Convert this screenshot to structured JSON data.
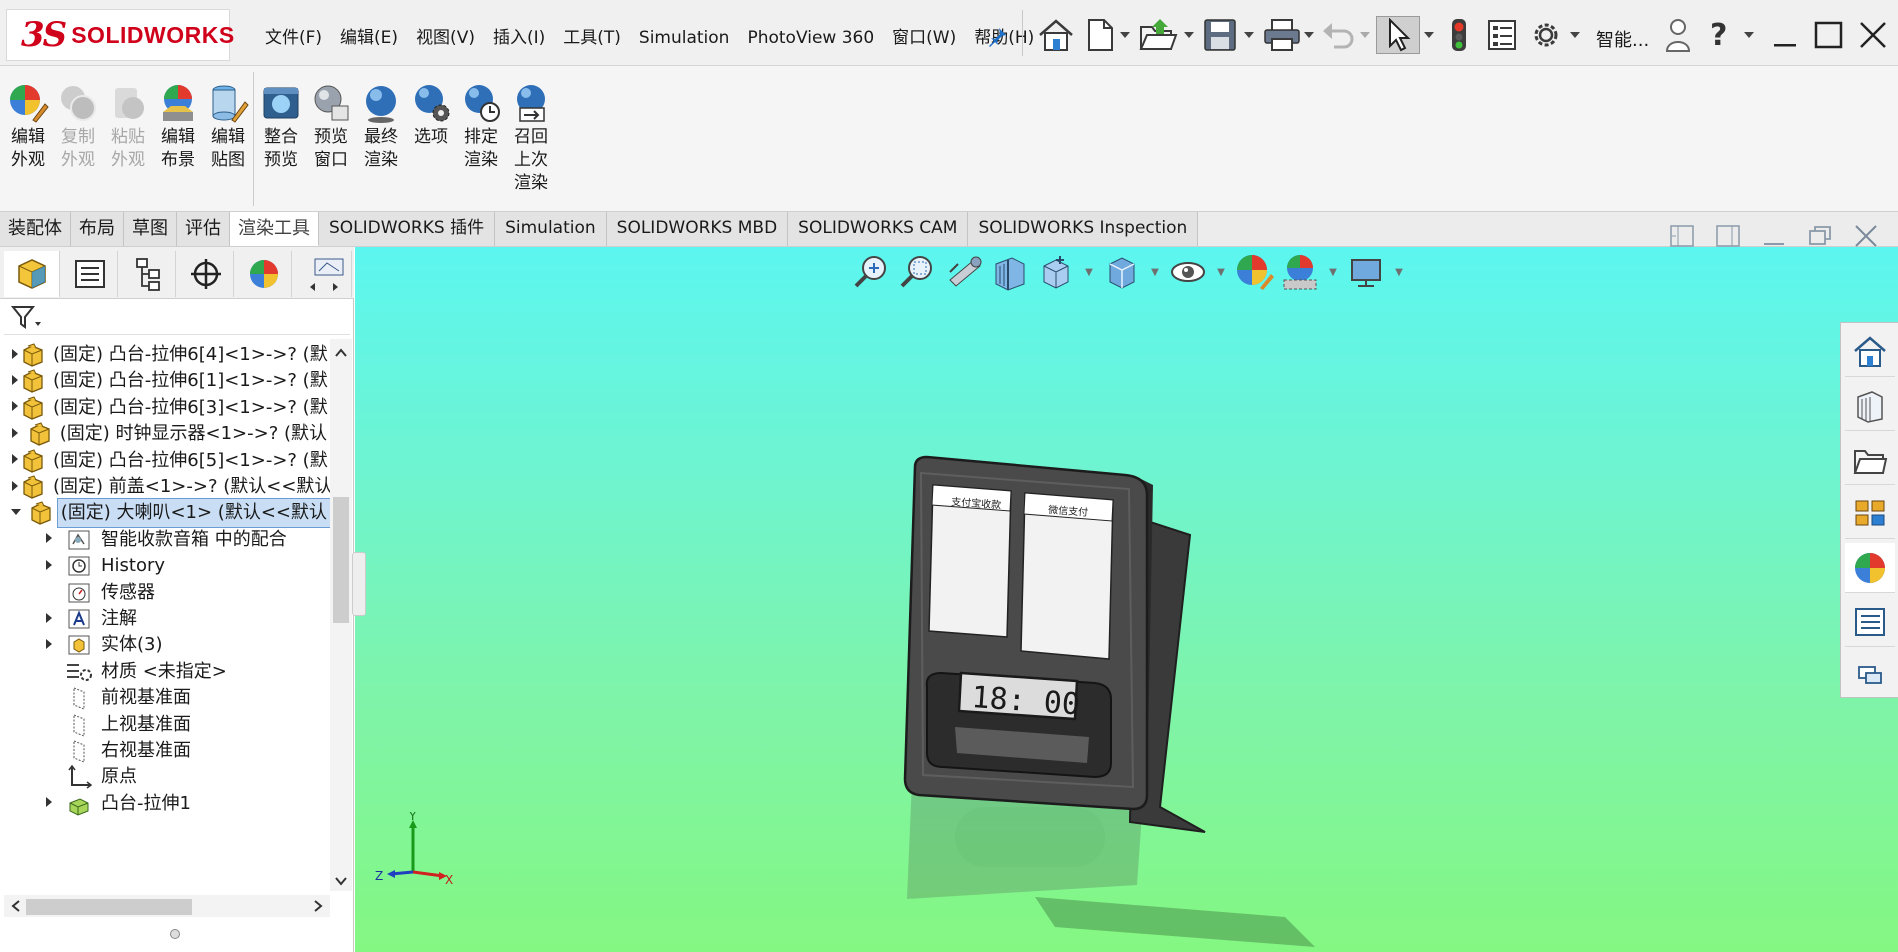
{
  "app": {
    "logo_mark": "3S",
    "logo_text": "SOLIDWORKS"
  },
  "menubar": {
    "items": [
      "文件(F)",
      "编辑(E)",
      "视图(V)",
      "插入(I)",
      "工具(T)",
      "Simulation",
      "PhotoView 360",
      "窗口(W)",
      "帮助(H)"
    ]
  },
  "quick_access": {
    "icons": [
      "home-icon",
      "new-document-icon",
      "open-icon",
      "save-icon",
      "print-icon",
      "undo-icon",
      "select-pointer-icon",
      "traffic-light-icon",
      "file-properties-icon",
      "options-gear-icon"
    ],
    "smart_label": "智能...",
    "help_glyph": "?"
  },
  "ribbon": {
    "buttons": [
      {
        "label": "编辑外观",
        "icon": "edit-appearance-icon",
        "enabled": true
      },
      {
        "label": "复制外观",
        "icon": "copy-appearance-icon",
        "enabled": false
      },
      {
        "label": "粘贴外观",
        "icon": "paste-appearance-icon",
        "enabled": false
      },
      {
        "label": "编辑布景",
        "icon": "edit-scene-icon",
        "enabled": true
      },
      {
        "label": "编辑贴图",
        "icon": "edit-decal-icon",
        "enabled": true
      },
      {
        "label": "整合预览",
        "icon": "integrated-preview-icon",
        "enabled": true
      },
      {
        "label": "预览窗口",
        "icon": "preview-window-icon",
        "enabled": true
      },
      {
        "label": "最终渲染",
        "icon": "final-render-icon",
        "enabled": true
      },
      {
        "label": "选项",
        "icon": "render-options-icon",
        "enabled": true
      },
      {
        "label": "排定渲染",
        "icon": "schedule-render-icon",
        "enabled": true
      },
      {
        "label": "召回上次渲染",
        "icon": "recall-last-render-icon",
        "enabled": true
      }
    ]
  },
  "tabs": {
    "items": [
      "装配体",
      "布局",
      "草图",
      "评估",
      "渲染工具",
      "SOLIDWORKS 插件",
      "Simulation",
      "SOLIDWORKS MBD",
      "SOLIDWORKS CAM",
      "SOLIDWORKS Inspection"
    ],
    "active": "渲染工具"
  },
  "feature_tree": {
    "rows": [
      {
        "text": "(固定) 凸台-拉伸6[4]<1>->? (默",
        "icon": "part-icon",
        "expander": "collapsed",
        "indent": 0
      },
      {
        "text": "(固定) 凸台-拉伸6[1]<1>->? (默",
        "icon": "part-icon",
        "expander": "collapsed",
        "indent": 0
      },
      {
        "text": "(固定) 凸台-拉伸6[3]<1>->? (默",
        "icon": "part-icon",
        "expander": "collapsed",
        "indent": 0
      },
      {
        "text": "(固定) 时钟显示器<1>->? (默认",
        "icon": "part-icon",
        "expander": "collapsed",
        "indent": 0
      },
      {
        "text": "(固定) 凸台-拉伸6[5]<1>->? (默",
        "icon": "part-icon",
        "expander": "collapsed",
        "indent": 0
      },
      {
        "text": "(固定) 前盖<1>->? (默认<<默认",
        "icon": "part-icon",
        "expander": "collapsed",
        "indent": 0
      },
      {
        "text": "(固定) 大喇叭<1> (默认<<默认",
        "icon": "part-icon",
        "expander": "expanded",
        "indent": 0,
        "selected": true
      },
      {
        "text": "智能收款音箱 中的配合",
        "icon": "mates-icon",
        "expander": "collapsed",
        "indent": 1
      },
      {
        "text": "History",
        "icon": "history-icon",
        "expander": "collapsed",
        "indent": 1
      },
      {
        "text": "传感器",
        "icon": "sensor-icon",
        "expander": "none",
        "indent": 1
      },
      {
        "text": "注解",
        "icon": "annotation-icon",
        "expander": "collapsed",
        "indent": 1
      },
      {
        "text": "实体(3)",
        "icon": "solid-bodies-icon",
        "expander": "collapsed",
        "indent": 1
      },
      {
        "text": "材质 <未指定>",
        "icon": "material-icon",
        "expander": "none",
        "indent": 1
      },
      {
        "text": "前视基准面",
        "icon": "plane-icon",
        "expander": "none",
        "indent": 1
      },
      {
        "text": "上视基准面",
        "icon": "plane-icon",
        "expander": "none",
        "indent": 1
      },
      {
        "text": "右视基准面",
        "icon": "plane-icon",
        "expander": "none",
        "indent": 1
      },
      {
        "text": "原点",
        "icon": "origin-icon",
        "expander": "none",
        "indent": 1
      },
      {
        "text": "凸台-拉伸1",
        "icon": "extrude-icon",
        "expander": "collapsed",
        "indent": 1
      }
    ]
  },
  "viewport": {
    "clock_display": "18: 00",
    "card_left_text": "支付宝收款",
    "card_right_text": "微信支付",
    "triad": {
      "x": "X",
      "y": "Y",
      "z": "Z"
    },
    "gradient_top": "#5cf6f0",
    "gradient_bottom": "#84f782"
  },
  "task_pane": {
    "icons": [
      "resources-home-icon",
      "design-library-icon",
      "file-explorer-icon",
      "view-palette-icon",
      "appearances-icon",
      "custom-properties-icon",
      "forum-icon"
    ],
    "active": "appearances-icon"
  }
}
